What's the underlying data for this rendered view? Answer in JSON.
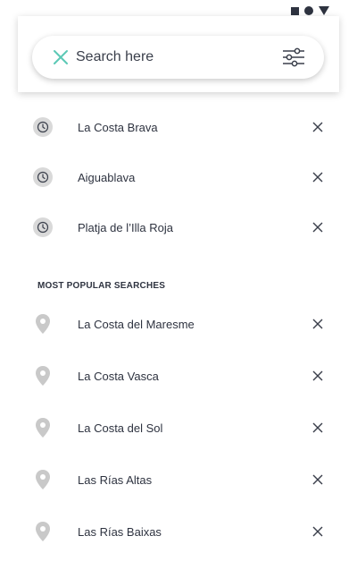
{
  "search": {
    "placeholder": "Search here",
    "value": ""
  },
  "icons": {
    "close": "x-icon",
    "filter": "sliders-icon",
    "recent": "clock-icon",
    "popular": "map-pin-icon",
    "remove": "x-icon"
  },
  "colors": {
    "accent": "#5cc9b6",
    "text": "#2e3340",
    "icon_gray": "#c9c9c9"
  },
  "recent": {
    "items": [
      {
        "label": "La Costa Brava"
      },
      {
        "label": "Aiguablava"
      },
      {
        "label": "Platja de l’Illa Roja"
      }
    ]
  },
  "popular": {
    "title": "MOST POPULAR SEARCHES",
    "items": [
      {
        "label": "La Costa del Maresme"
      },
      {
        "label": "La Costa Vasca"
      },
      {
        "label": "La Costa del Sol"
      },
      {
        "label": "Las Rías Altas"
      },
      {
        "label": "Las Rías Baixas"
      }
    ]
  }
}
